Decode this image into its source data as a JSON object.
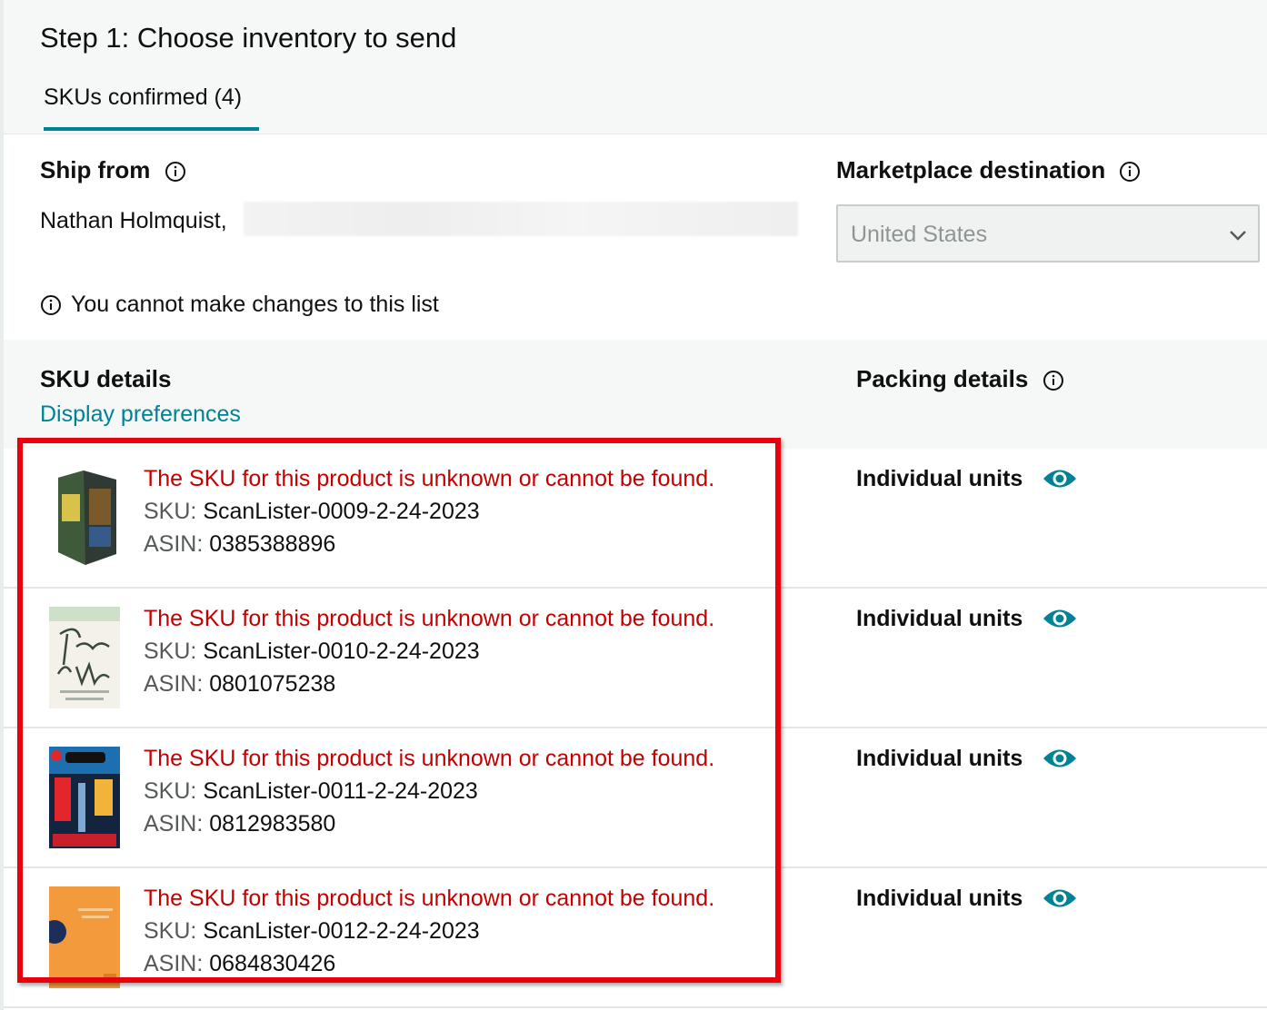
{
  "step": {
    "title": "Step 1: Choose inventory to send"
  },
  "tabs": [
    {
      "label": "SKUs confirmed (4)"
    }
  ],
  "ship_from": {
    "heading": "Ship from",
    "name": "Nathan Holmquist, "
  },
  "marketplace": {
    "heading": "Marketplace destination",
    "value": "United States"
  },
  "notice": "You cannot make changes to this list",
  "sku_details": {
    "heading": "SKU details",
    "display_link": "Display preferences"
  },
  "packing_details": {
    "heading": "Packing details"
  },
  "rows": [
    {
      "error": "The SKU for this product is unknown or cannot be found.",
      "sku_label": "SKU:",
      "sku": "ScanLister-0009-2-24-2023",
      "asin_label": "ASIN:",
      "asin": "0385388896",
      "packing": "Individual units"
    },
    {
      "error": "The SKU for this product is unknown or cannot be found.",
      "sku_label": "SKU:",
      "sku": "ScanLister-0010-2-24-2023",
      "asin_label": "ASIN:",
      "asin": "0801075238",
      "packing": "Individual units"
    },
    {
      "error": "The SKU for this product is unknown or cannot be found.",
      "sku_label": "SKU:",
      "sku": "ScanLister-0011-2-24-2023",
      "asin_label": "ASIN:",
      "asin": "0812983580",
      "packing": "Individual units"
    },
    {
      "error": "The SKU for this product is unknown or cannot be found.",
      "sku_label": "SKU:",
      "sku": "ScanLister-0012-2-24-2023",
      "asin_label": "ASIN:",
      "asin": "0684830426",
      "packing": "Individual units"
    }
  ],
  "colors": {
    "teal": "#008296",
    "error": "#c40000",
    "highlight": "#e8000b"
  },
  "icons": {
    "info": "info-icon",
    "eye": "eye-icon",
    "chevron": "chevron-down-icon"
  }
}
